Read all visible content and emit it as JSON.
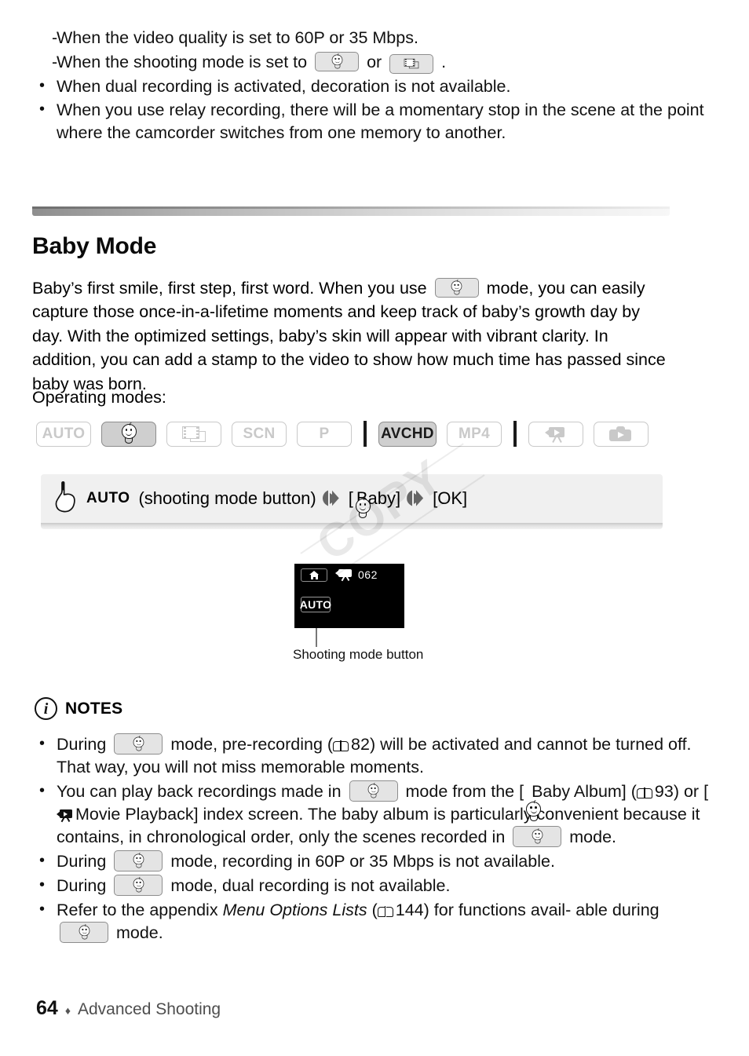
{
  "document": {
    "page_number": "64",
    "footer_separator": "♦",
    "section_name": "Advanced Shooting"
  },
  "top_list": {
    "sub_items": [
      {
        "dash": "-",
        "text": "When the video quality is set to 60P or 35 Mbps."
      },
      {
        "dash": "-",
        "text_before": "When the shooting mode is set to",
        "icon1": "baby-mode-icon",
        "text_mid": "or",
        "icon2": "cinema-mode-icon",
        "text_after": "."
      }
    ],
    "bullets": [
      {
        "dot": "•",
        "text": "When dual recording is activated, decoration is not available."
      },
      {
        "dot": "•",
        "text": "When you use relay recording, there will be a momentary stop in the scene at the point where the camcorder switches from one memory to another."
      }
    ]
  },
  "section": {
    "heading": "Baby Mode",
    "intro_part1": "Baby’s first smile, first step, first word. When you use",
    "intro_icon": "baby-mode-icon",
    "intro_part2": "mode, you can easily capture those once-in-a-lifetime moments and keep track of baby’s growth day by day. With the optimized settings, baby’s skin will appear with vibrant clarity. In addition, you can add a stamp to the video to show how much time has passed since baby was born.",
    "operating_modes_label": "Operating modes:"
  },
  "mode_row": {
    "badges": [
      {
        "name": "mode-auto",
        "label": "AUTO",
        "type": "text",
        "active": false
      },
      {
        "name": "mode-baby",
        "label": "",
        "type": "baby",
        "active": true
      },
      {
        "name": "mode-cinema",
        "label": "",
        "type": "film",
        "active": false
      },
      {
        "name": "mode-scn",
        "label": "SCN",
        "type": "text",
        "active": false
      },
      {
        "name": "mode-p",
        "label": "P",
        "type": "text",
        "active": false
      },
      {
        "name": "separator-1",
        "type": "separator"
      },
      {
        "name": "format-avchd",
        "label": "AVCHD",
        "type": "text",
        "active": true
      },
      {
        "name": "format-mp4",
        "label": "MP4",
        "type": "text",
        "active": false
      },
      {
        "name": "separator-2",
        "type": "separator"
      },
      {
        "name": "playback-movie",
        "label": "",
        "type": "movieplay",
        "active": false
      },
      {
        "name": "playback-photo",
        "label": "",
        "type": "photoplay",
        "active": false
      }
    ]
  },
  "instruction": {
    "hand_icon": "pointing-hand-icon",
    "auto_label": "AUTO",
    "step1": "(shooting mode button)",
    "arrow": "❯❯",
    "step2_open": "[",
    "step2_label": "Baby]",
    "step3": "[OK]",
    "watermark": "COPY"
  },
  "figure": {
    "home_button_icon": "home-icon",
    "record_camera_icon": "movie-camera-icon",
    "record_count": "062",
    "auto_button_label": "AUTO",
    "caption": "Shooting mode button"
  },
  "notes": {
    "icon": "info-icon",
    "icon_glyph": "i",
    "title": "NOTES",
    "items": [
      {
        "id": "note-prerecording",
        "dot": "•",
        "part1": "During",
        "badge": "baby-mode-icon",
        "part2": "mode, pre-recording (",
        "book_icon": "book-icon",
        "page_ref": "82",
        "part3": ") will be activated and cannot be turned off. That way, you will not miss memorable moments."
      },
      {
        "id": "note-baby-album",
        "dot": "•",
        "part1": "You can play back recordings made in",
        "badge": "baby-mode-icon",
        "part2": "mode from the [",
        "inline_baby_icon": "baby-icon",
        "part3": "Baby Album] (",
        "book_icon": "book-icon",
        "page_ref": "93",
        "part4": ") or [",
        "movie_icon": "movie-playback-icon",
        "part5": "Movie Playback] index screen. The baby album is particularly convenient because it contains, in chronological order, only the scenes recorded in",
        "badge2": "baby-mode-icon",
        "part6": "mode."
      },
      {
        "id": "note-60p",
        "dot": "•",
        "part1": "During",
        "badge": "baby-mode-icon",
        "part2": "mode, recording in 60P or 35 Mbps is not available."
      },
      {
        "id": "note-dual-recording",
        "dot": "•",
        "part1": "During",
        "badge": "baby-mode-icon",
        "part2": "mode, dual recording is not available."
      },
      {
        "id": "note-menu-options",
        "dot": "•",
        "part1": "Refer to the appendix",
        "italic": "Menu Options Lists",
        "part2": "(",
        "book_icon": "book-icon",
        "page_ref": "144",
        "part3": ") for functions avail-",
        "part4": "able during",
        "badge": "baby-mode-icon",
        "part5": "mode."
      }
    ]
  },
  "colors": {
    "badge_inactive_border": "#c9c9c9",
    "badge_active_bg": "#cfcfcf",
    "instruction_bar_bg": "#f0f0f0",
    "screen_bg": "#000000",
    "footer_section_color": "#4e4e4e"
  }
}
